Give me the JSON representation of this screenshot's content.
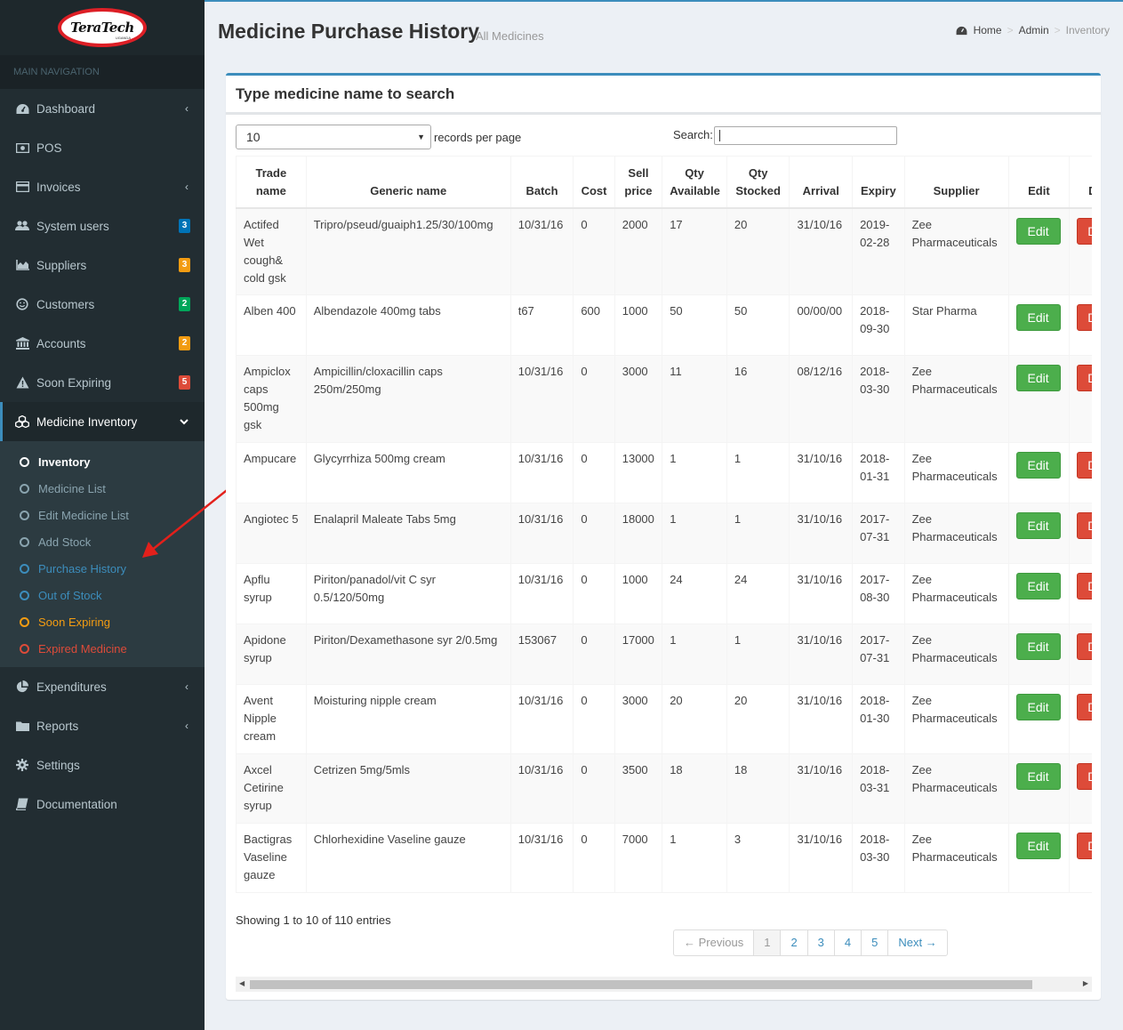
{
  "brand": {
    "logo_text": "TeraTech",
    "logo_sub": "UGANDA"
  },
  "sidebar": {
    "header": "MAIN NAVIGATION",
    "items": [
      {
        "label": "Dashboard",
        "icon": "dashboard-icon",
        "chevron": "‹"
      },
      {
        "label": "POS",
        "icon": "money-icon"
      },
      {
        "label": "Invoices",
        "icon": "credit-card-icon",
        "chevron": "‹"
      },
      {
        "label": "System users",
        "icon": "users-icon",
        "badge": "3",
        "badge_color": "#0073b7"
      },
      {
        "label": "Suppliers",
        "icon": "area-chart-icon",
        "badge": "3",
        "badge_color": "#f39c12"
      },
      {
        "label": "Customers",
        "icon": "smile-icon",
        "badge": "2",
        "badge_color": "#00a65a"
      },
      {
        "label": "Accounts",
        "icon": "bank-icon",
        "badge": "2",
        "badge_color": "#f39c12"
      },
      {
        "label": "Soon Expiring",
        "icon": "warning-icon",
        "badge": "5",
        "badge_color": "#dd4b39"
      },
      {
        "label": "Medicine Inventory",
        "icon": "cubes-icon",
        "chevron": "⌄"
      }
    ],
    "submenu": [
      {
        "label": "Inventory",
        "color": "#ffffff"
      },
      {
        "label": "Medicine List",
        "color": "#8aa4af"
      },
      {
        "label": "Edit Medicine List",
        "color": "#8aa4af"
      },
      {
        "label": "Add Stock",
        "color": "#8aa4af"
      },
      {
        "label": "Purchase History",
        "color": "#3c8dbc"
      },
      {
        "label": "Out of Stock",
        "color": "#3c8dbc"
      },
      {
        "label": "Soon Expiring",
        "color": "#f39c12"
      },
      {
        "label": "Expired Medicine",
        "color": "#dd4b39"
      }
    ],
    "bottom_items": [
      {
        "label": "Expenditures",
        "icon": "pie-chart-icon",
        "chevron": "‹"
      },
      {
        "label": "Reports",
        "icon": "folder-icon",
        "chevron": "‹"
      },
      {
        "label": "Settings",
        "icon": "gear-icon"
      },
      {
        "label": "Documentation",
        "icon": "book-icon"
      }
    ]
  },
  "header": {
    "title": "Medicine Purchase History",
    "subtitle": "All Medicines",
    "breadcrumb": [
      "Home",
      "Admin",
      "Inventory"
    ]
  },
  "box": {
    "title": "Type medicine name to search",
    "length_value": "10",
    "length_label": "records per page",
    "search_label": "Search:",
    "search_value": ""
  },
  "table": {
    "columns": [
      "Trade name",
      "Generic name",
      "Batch",
      "Cost",
      "Sell price",
      "Qty Available",
      "Qty Stocked",
      "Arrival",
      "Expiry",
      "Supplier",
      "Edit",
      "Delete"
    ],
    "edit_label": "Edit",
    "delete_label": "Delete",
    "rows": [
      [
        "Actifed Wet cough& cold gsk",
        "Tripro/pseud/guaiph1.25/30/100mg",
        "10/31/16",
        "0",
        "2000",
        "17",
        "20",
        "31/10/16",
        "2019-02-28",
        "Zee Pharmaceuticals"
      ],
      [
        "Alben 400",
        "Albendazole 400mg tabs",
        "t67",
        "600",
        "1000",
        "50",
        "50",
        "00/00/00",
        "2018-09-30",
        "Star Pharma"
      ],
      [
        "Ampiclox caps 500mg gsk",
        "Ampicillin/cloxacillin caps 250m/250mg",
        "10/31/16",
        "0",
        "3000",
        "11",
        "16",
        "08/12/16",
        "2018-03-30",
        "Zee Pharmaceuticals"
      ],
      [
        "Ampucare",
        "Glycyrrhiza 500mg cream",
        "10/31/16",
        "0",
        "13000",
        "1",
        "1",
        "31/10/16",
        "2018-01-31",
        "Zee Pharmaceuticals"
      ],
      [
        "Angiotec 5",
        "Enalapril Maleate Tabs 5mg",
        "10/31/16",
        "0",
        "18000",
        "1",
        "1",
        "31/10/16",
        "2017-07-31",
        "Zee Pharmaceuticals"
      ],
      [
        "Apflu syrup",
        "Piriton/panadol/vit C syr 0.5/120/50mg",
        "10/31/16",
        "0",
        "1000",
        "24",
        "24",
        "31/10/16",
        "2017-08-30",
        "Zee Pharmaceuticals"
      ],
      [
        "Apidone syrup",
        "Piriton/Dexamethasone syr 2/0.5mg",
        "153067",
        "0",
        "17000",
        "1",
        "1",
        "31/10/16",
        "2017-07-31",
        "Zee Pharmaceuticals"
      ],
      [
        "Avent Nipple cream",
        "Moisturing nipple cream",
        "10/31/16",
        "0",
        "3000",
        "20",
        "20",
        "31/10/16",
        "2018-01-30",
        "Zee Pharmaceuticals"
      ],
      [
        "Axcel Cetirine syrup",
        "Cetrizen 5mg/5mls",
        "10/31/16",
        "0",
        "3500",
        "18",
        "18",
        "31/10/16",
        "2018-03-31",
        "Zee Pharmaceuticals"
      ],
      [
        "Bactigras Vaseline gauze",
        "Chlorhexidine Vaseline gauze",
        "10/31/16",
        "0",
        "7000",
        "1",
        "3",
        "31/10/16",
        "2018-03-30",
        "Zee Pharmaceuticals"
      ]
    ]
  },
  "footer": {
    "info": "Showing 1 to 10 of 110 entries",
    "pages": [
      "← Previous",
      "1",
      "2",
      "3",
      "4",
      "5",
      "Next →"
    ]
  }
}
